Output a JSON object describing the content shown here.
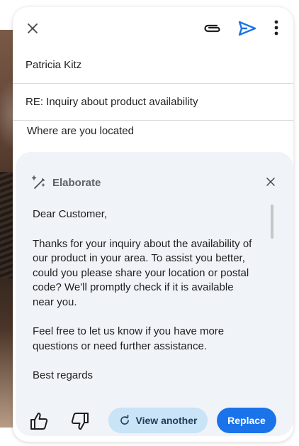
{
  "compose": {
    "to": "Patricia Kitz",
    "subject": "RE: Inquiry about product availability",
    "body": "Where are you located"
  },
  "toolbar": {
    "close_icon": "close-icon",
    "attach_icon": "attachment-icon",
    "send_icon": "send-icon",
    "more_icon": "more-vert-icon",
    "send_color": "#1a73e8"
  },
  "assist_panel": {
    "title": "Elaborate",
    "title_icon": "magic-wand-icon",
    "paragraphs": [
      "Dear Customer,",
      "Thanks for your inquiry about the availability of our product in your area. To assist you better, could you please share your location or postal code? We'll promptly check if it is available near you.",
      "Feel free to let us know if you have more questions or need further assistance.",
      "Best regards"
    ],
    "view_another_label": "View another",
    "replace_label": "Replace",
    "accent_color": "#1a73e8"
  }
}
